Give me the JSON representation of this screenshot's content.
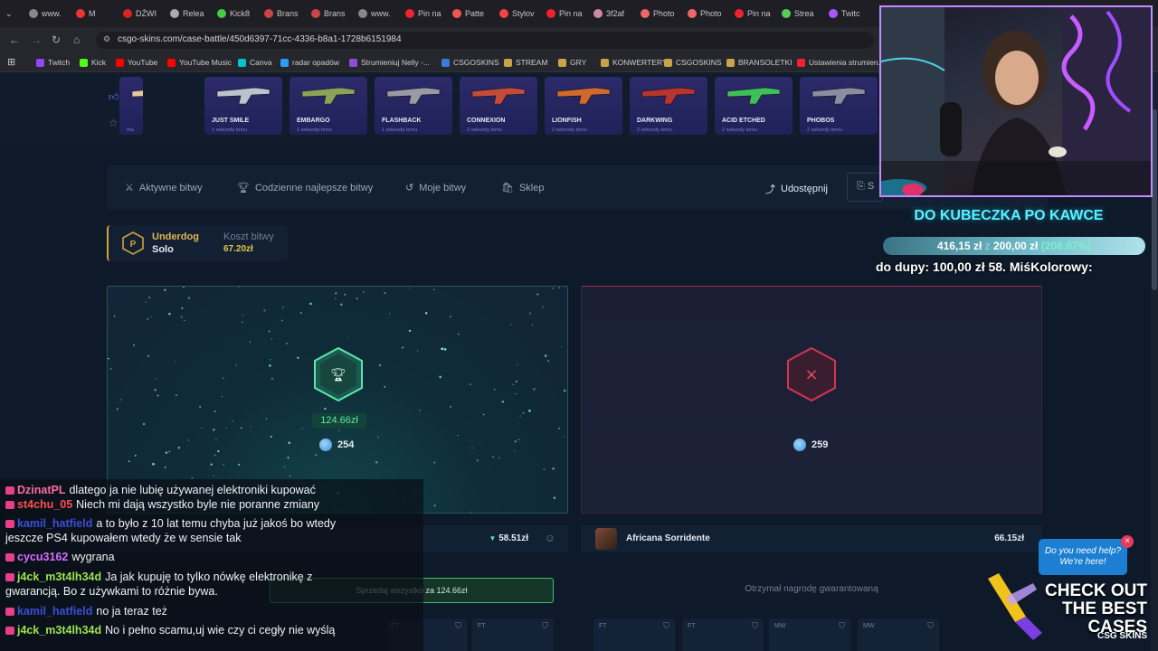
{
  "browser": {
    "tabs": [
      "www.",
      "M",
      "DŹWI",
      "Relea",
      "Kick8",
      "Brans",
      "Brans",
      "www.",
      "Pin na",
      "Patte",
      "Stylov",
      "Pin na",
      "3f2af",
      "Photo",
      "Photo",
      "Pin na",
      "Strea",
      "Twitc"
    ],
    "url": "csgo-skins.com/case-battle/450d6397-71cc-4336-b8a1-1728b6151984",
    "bookmarks": [
      "Twitch",
      "Kick",
      "YouTube",
      "YouTube Music",
      "Canva",
      "radar opadów",
      "Strumieniuj Nelly -...",
      "CSGOSKINS",
      "STREAM",
      "GRY",
      "KONWERTERY",
      "CSGOSKINS",
      "BRANSOLETKI",
      "Ustawienia strumien..."
    ]
  },
  "drops": [
    {
      "name": "",
      "time": "ma",
      "color": "#e0c9a0"
    },
    {
      "name": "JUST SMILE",
      "time": "1 sekundę temu",
      "color": "#b9c3cf"
    },
    {
      "name": "EMBARGO",
      "time": "1 sekundę temu",
      "color": "#8aa358"
    },
    {
      "name": "FLASHBACK",
      "time": "1 sekundę temu",
      "color": "#9a9aa6"
    },
    {
      "name": "CONNEXION",
      "time": "2 sekundy temu",
      "color": "#c44a3a"
    },
    {
      "name": "LIONFISH",
      "time": "2 sekundy temu",
      "color": "#d06a2a"
    },
    {
      "name": "DARKWING",
      "time": "2 sekundy temu",
      "color": "#b7352f"
    },
    {
      "name": "ACID ETCHED",
      "time": "2 sekundy temu",
      "color": "#3fbf5a"
    },
    {
      "name": "PHOBOS",
      "time": "2 sekundy temu",
      "color": "#8a8ea0"
    },
    {
      "name": "PHOBOS",
      "time": "3 sekundy temu",
      "color": "#8a8ea0"
    }
  ],
  "nav": {
    "active": "Aktywne bitwy",
    "daily": "Codzienne najlepsze bitwy",
    "mine": "Moje bitwy",
    "shop": "Sklep",
    "share": "Udostępnij",
    "share_extra": "S"
  },
  "mode": {
    "name": "Underdog",
    "type": "Solo",
    "cost_label": "Koszt bitwy",
    "cost_value": "67.20zł"
  },
  "players": {
    "left": {
      "prize": "124.66zł",
      "coins": "254",
      "row_value": "58.51zł",
      "sell_label": "Sprzedaj wszystko za 124.66zł",
      "qualities": [
        "FT",
        "FT"
      ]
    },
    "right": {
      "name": "Africana Sorridente",
      "coins": "259",
      "row_value": "66.15zł",
      "guarantee": "Otrzymał nagrodę gwarantowaną",
      "qualities": [
        "FT",
        "FT",
        "MW",
        "MW"
      ]
    }
  },
  "chat": [
    {
      "user": "DzinatPL",
      "color": "#ff6aa0",
      "text": "dlatego ja nie lubię używanej elektroniki kupować"
    },
    {
      "user": "st4chu_05",
      "color": "#ff4d4d",
      "text": "Niech mi dają wszystko byle nie poranne zmiany"
    },
    {
      "user": "kamil_hatfield",
      "color": "#3b4fd6",
      "text": "a to było z 10 lat temu chyba już jakoś bo wtedy"
    },
    {
      "user": "",
      "color": "#f2f2f2",
      "text": "jeszcze PS4 kupowałem wtedy że w sensie tak"
    },
    {
      "user": "cycu3162",
      "color": "#d76bff",
      "text": "wygrana"
    },
    {
      "user": "j4ck_m3t4lh34d",
      "color": "#9be34d",
      "text": "Ja jak kupuję to tylko nówkę elektronikę z"
    },
    {
      "user": "",
      "color": "#f2f2f2",
      "text": "gwarancją. Bo z używkami to różnie bywa."
    },
    {
      "user": "kamil_hatfield",
      "color": "#3b4fd6",
      "text": "no ja teraz też"
    },
    {
      "user": "j4ck_m3t4lh34d",
      "color": "#9be34d",
      "text": "No i pełno scamu,uj wie czy ci cegły nie wyślą"
    }
  ],
  "stream": {
    "goal_title": "DO KUBECZKA PO KAWCE",
    "goal_current": "416,15 zł",
    "goal_sep": "z",
    "goal_target": "200,00 zł",
    "goal_pct": "(208.07%)",
    "goal_progress": 1.0,
    "ticker": "do dupy: 100,00 zł   58. MiśKolorowy:",
    "promo_q1": "Do you need help?",
    "promo_q2": "We're here!",
    "promo_l1": "CHECK OUT",
    "promo_l2": "THE BEST",
    "promo_l3": "CASES",
    "promo_brand": "CSG SKINS"
  }
}
